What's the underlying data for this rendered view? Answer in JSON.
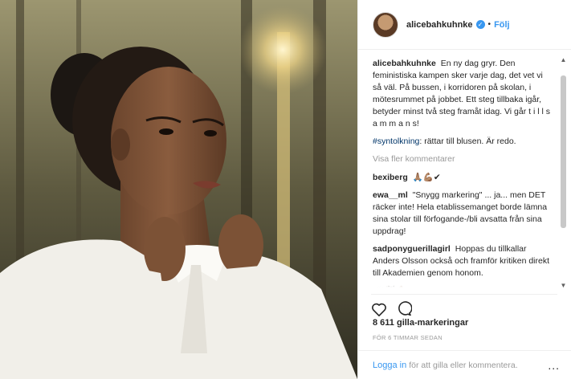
{
  "header": {
    "username": "alicebahkuhnke",
    "verified_icon": "verified-badge-icon",
    "separator": "•",
    "follow_label": "Följ"
  },
  "comments": [
    {
      "user": "alicebahkuhnke",
      "text": "En ny dag gryr. Den feministiska kampen sker varje dag, det vet vi så väl. På bussen, i korridoren på skolan, i mötesrummet på jobbet. Ett steg tillbaka igår, betyder minst två steg framåt idag. Vi går t i l l s a m m a n s!"
    },
    {
      "hashtag": "#syntolkning",
      "text": ": rättar till blusen. Är redo."
    }
  ],
  "more_comments_label": "Visa fler kommentarer",
  "replies": [
    {
      "user": "bexiberg",
      "text": "🙏🏽💪🏽✔"
    },
    {
      "user": "ewa__ml",
      "text": "\"Snygg markering\" ... ja... men DET räcker inte! Hela etablissemanget borde lämna sina stolar till förfogande-/bli avsatta från sina uppdrag!"
    },
    {
      "user": "sadponyguerillagirl",
      "text": "Hoppas du tillkallar Anders Olsson också och framför kritiken direkt till Akademien genom honom."
    },
    {
      "user": "",
      "text": "🙌🏽🏁💪🏽"
    }
  ],
  "actions": {
    "like_icon": "heart-icon",
    "comment_icon": "comment-bubble-icon"
  },
  "likes_text": "8 611 gilla-markeringar",
  "timestamp": "FÖR 6 TIMMAR SEDAN",
  "footer": {
    "login_label": "Logga in",
    "login_rest": "för att gilla eller kommentera.",
    "options_label": "..."
  },
  "scrollbar": {
    "up_arrow": "▲",
    "down_arrow": "▼"
  }
}
